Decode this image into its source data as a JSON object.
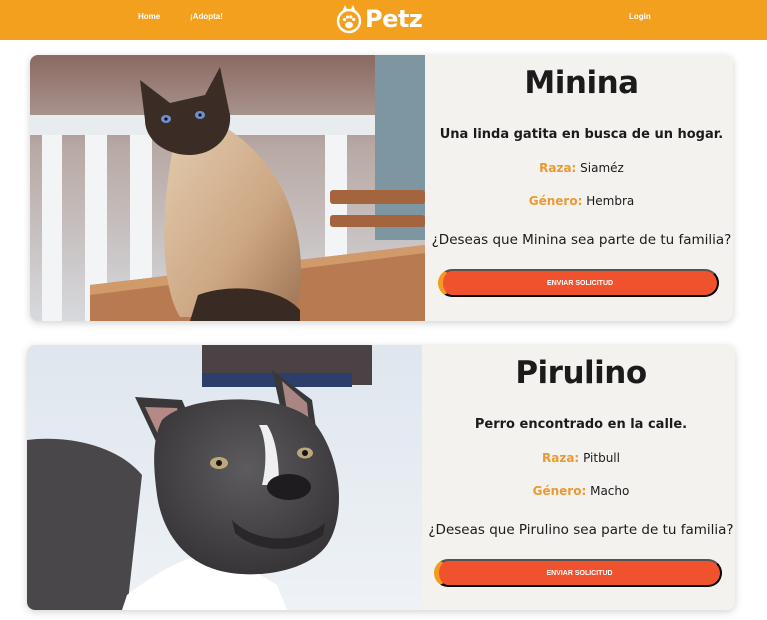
{
  "nav": {
    "home": "Home",
    "adopta": "¡Adopta!",
    "logo_text": "Petz",
    "login": "Login"
  },
  "colors": {
    "brand_orange": "#f3a01e",
    "button_red": "#f0522e",
    "label_orange": "#ea9a33",
    "card_bg": "#f4f2ef"
  },
  "pets": [
    {
      "name": "Minina",
      "description": "Una linda gatita en busca de un hogar.",
      "raza_label": "Raza:",
      "raza": "Siaméz",
      "genero_label": "Género:",
      "genero": "Hembra",
      "question": "¿Deseas que Minina sea parte de tu familia?",
      "button": "ENVIAR SOLICITUD",
      "photo": "siamese-cat-photo"
    },
    {
      "name": "Pirulino",
      "description": "Perro encontrado en la calle.",
      "raza_label": "Raza:",
      "raza": "Pitbull",
      "genero_label": "Género:",
      "genero": "Macho",
      "question": "¿Deseas que Pirulino sea parte de tu familia?",
      "button": "ENVIAR SOLICITUD",
      "photo": "pitbull-dog-photo"
    }
  ]
}
